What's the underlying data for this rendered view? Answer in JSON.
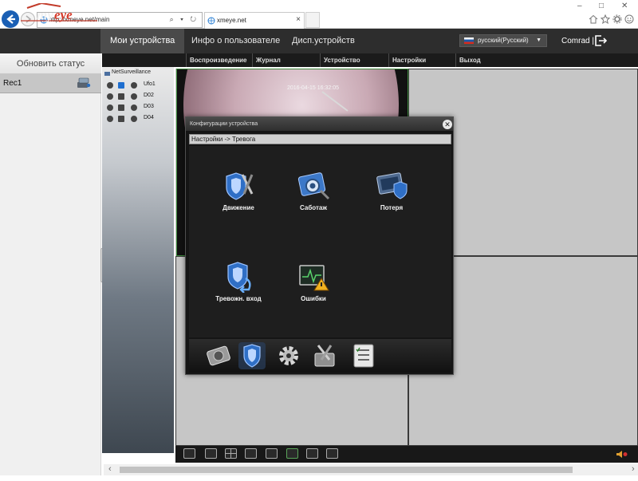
{
  "browser": {
    "url": "http://xmeye.net/main",
    "tab_title": "xmeye.net",
    "search_glyph": "⌕ ▾ ↻",
    "close_glyph": "×",
    "window_buttons": [
      "–",
      "□",
      "✕"
    ],
    "toolbar_icons": [
      "home-icon",
      "star-icon",
      "gear-icon",
      "smiley-icon"
    ]
  },
  "app": {
    "nav": [
      "Мои устройства",
      "Инфо о пользователе",
      "Дисп.устройств"
    ],
    "language": "русский(Русский)",
    "user": "Comrad",
    "separator": "|"
  },
  "menu": [
    "Воспроизведение",
    "Журнал",
    "Устройство",
    "Настройки",
    "Выход"
  ],
  "sidebar": {
    "refresh_label": "Обновить статус",
    "device": "Rec1"
  },
  "tree": {
    "root": "NetSurveillance",
    "channels": [
      "Ufo1",
      "D02",
      "D03",
      "D04"
    ]
  },
  "camera": {
    "timestamp": "2016-04-15 16:32:05"
  },
  "dialog": {
    "title": "Конфигурации устройства",
    "breadcrumb": "Настройки -> Тревога",
    "items": [
      {
        "label": "Движение",
        "icon": "motion-shield-tools-icon"
      },
      {
        "label": "Саботаж",
        "icon": "camera-tamper-icon"
      },
      {
        "label": "Потеря",
        "icon": "video-loss-icon"
      },
      {
        "label": "Тревожн. вход",
        "icon": "alarm-input-icon"
      },
      {
        "label": "Ошибки",
        "icon": "error-warning-icon"
      }
    ],
    "footer_icons": [
      "disk-icon",
      "shield-icon",
      "settings-gear-icon",
      "system-tools-icon",
      "info-list-icon"
    ]
  },
  "colors": {
    "header_bg": "#2d2d2d",
    "menu_bg": "#1b1b1b",
    "accent_blue": "#1a5fb4",
    "cam_border": "#3c8a3c"
  }
}
